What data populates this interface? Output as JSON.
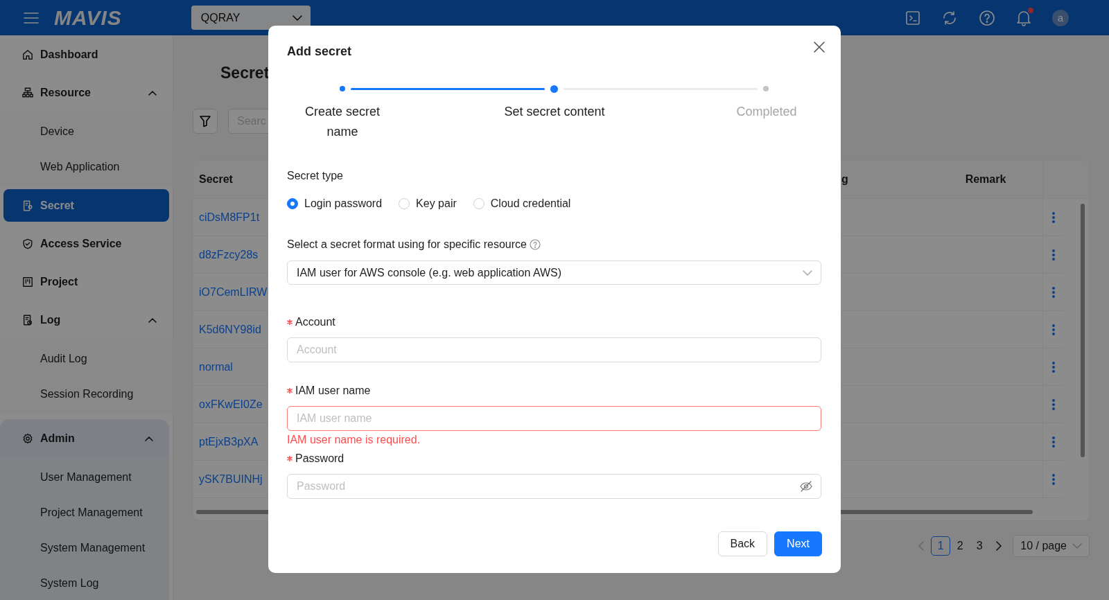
{
  "header": {
    "logo": "MAVIS",
    "project": "QQRAY",
    "unread": true,
    "avatar_initial": "a"
  },
  "sidebar": {
    "items": [
      {
        "label": "Dashboard",
        "selected": false
      },
      {
        "label": "Resource",
        "selected": false,
        "expanded": true,
        "children": [
          {
            "label": "Device",
            "selected": false
          },
          {
            "label": "Web Application",
            "selected": false
          }
        ]
      },
      {
        "label": "Secret",
        "selected": true
      },
      {
        "label": "Access Service",
        "selected": false
      },
      {
        "label": "Project",
        "selected": false
      },
      {
        "label": "Log",
        "selected": false,
        "expanded": true,
        "children": [
          {
            "label": "Audit Log",
            "selected": false
          },
          {
            "label": "Session Recording",
            "selected": false
          }
        ]
      },
      {
        "label": "Admin",
        "selected": false,
        "expanded": true,
        "hovered": true,
        "children": [
          {
            "label": "User Management",
            "selected": false
          },
          {
            "label": "Project Management",
            "selected": false
          },
          {
            "label": "System Management",
            "selected": false
          },
          {
            "label": "System Log",
            "selected": false
          }
        ]
      }
    ]
  },
  "page": {
    "title": "Secret",
    "search_placeholder": "Searc",
    "table": {
      "columns": [
        "Secret",
        "g",
        "Remark"
      ],
      "rows": [
        {
          "secret": "ciDsM8FP1t"
        },
        {
          "secret": "d8zFzcy28s"
        },
        {
          "secret": "iO7CemLIRW"
        },
        {
          "secret": "K5d6NY98id"
        },
        {
          "secret": "normal"
        },
        {
          "secret": "oxFKwEI0Ze"
        },
        {
          "secret": "ptEjxB3pXA"
        },
        {
          "secret": "ySK7BUINHj"
        }
      ]
    },
    "pagination": {
      "pages": [
        {
          "label": "1",
          "selected": true
        },
        {
          "label": "2",
          "selected": false
        },
        {
          "label": "3",
          "selected": false
        }
      ],
      "page_size": "10 / page"
    }
  },
  "dialog": {
    "title": "Add secret",
    "steps": [
      {
        "label": "Create secret name",
        "finished": true,
        "current": false
      },
      {
        "label": "Set secret content",
        "finished": false,
        "current": true
      },
      {
        "label": "Completed",
        "finished": false,
        "current": false
      }
    ],
    "secret_type": {
      "label": "Secret type",
      "options": [
        {
          "label": "Login password",
          "selected": true
        },
        {
          "label": "Key pair",
          "selected": false
        },
        {
          "label": "Cloud credential",
          "selected": false
        }
      ]
    },
    "format": {
      "label": "Select a secret format using for specific resource",
      "value": "IAM user for AWS console (e.g. web application AWS)"
    },
    "fields": [
      {
        "label": "Account",
        "placeholder": "Account",
        "required": true,
        "kind": "text"
      },
      {
        "label": "IAM user name",
        "placeholder": "IAM user name",
        "required": true,
        "kind": "text",
        "error": "IAM user name is required."
      },
      {
        "label": "Password",
        "placeholder": "Password",
        "required": true,
        "kind": "password"
      }
    ],
    "buttons": [
      {
        "label": "Back",
        "kind": "default"
      },
      {
        "label": "Next",
        "kind": "primary"
      }
    ]
  }
}
